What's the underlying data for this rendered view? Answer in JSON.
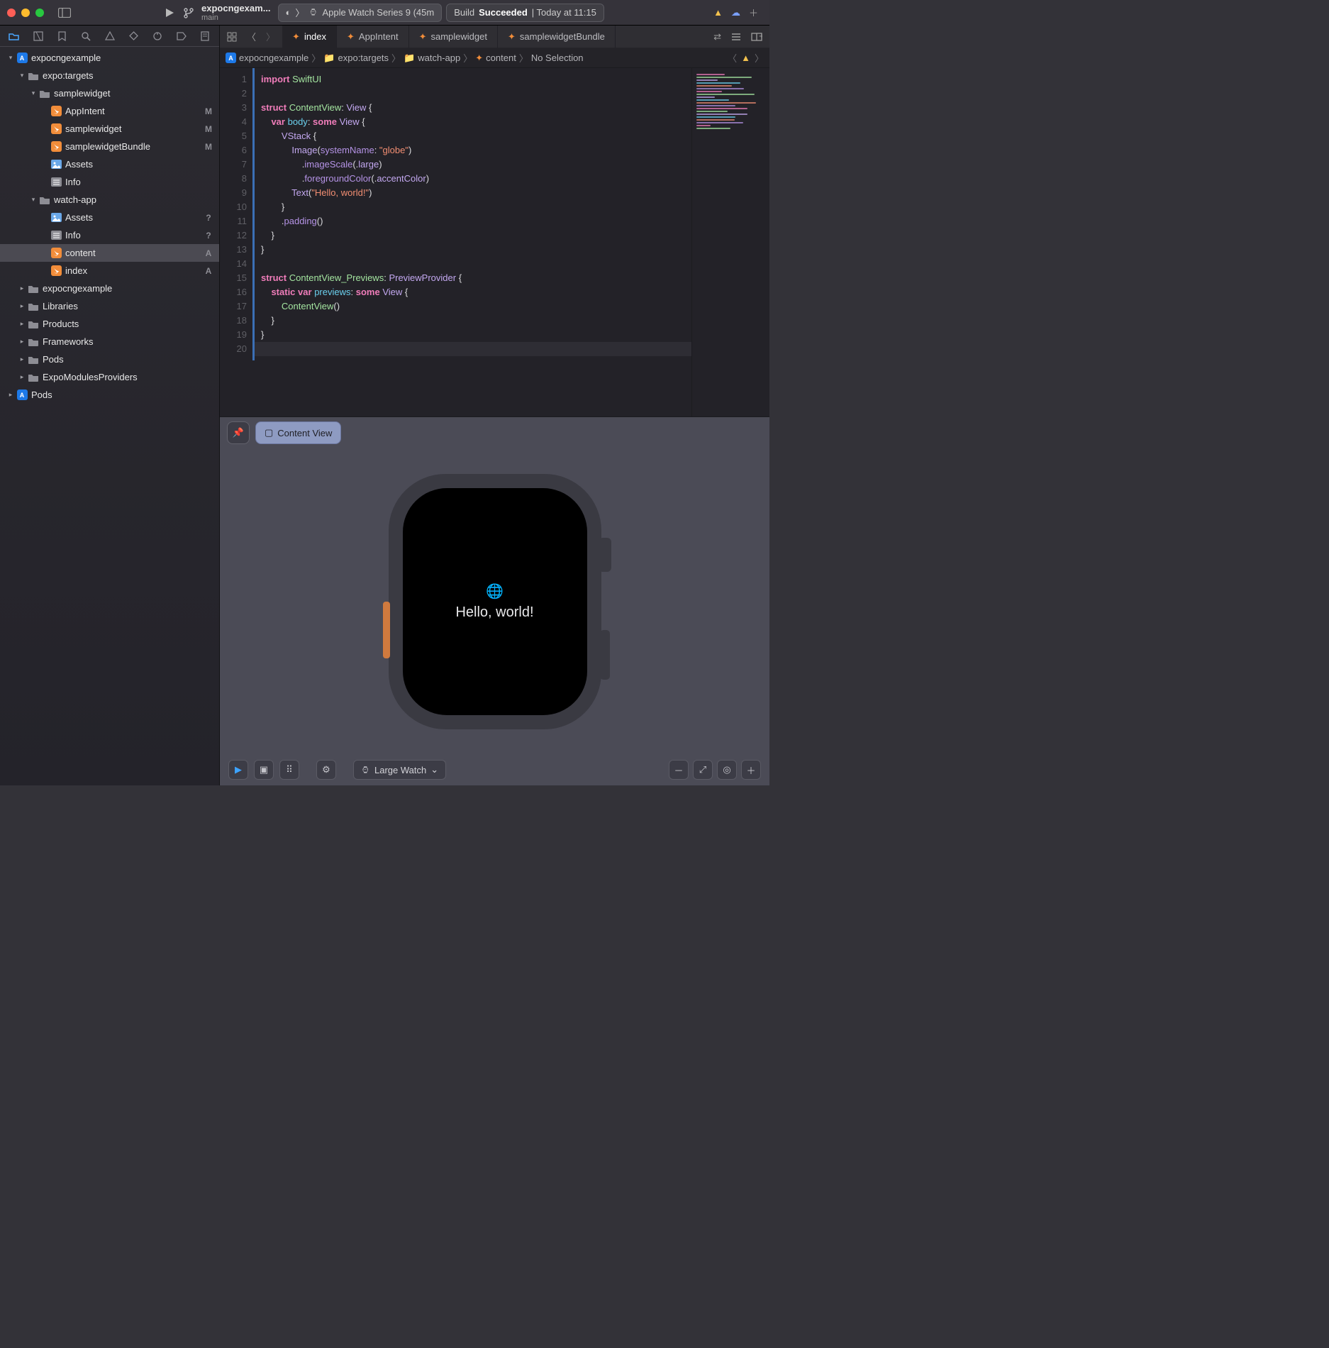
{
  "titlebar": {
    "project": "expocngexam...",
    "branch": "main",
    "schemeArrow": "〉",
    "device": "Apple Watch Series 9 (45m",
    "statusPrefix": "Build ",
    "statusStrong": "Succeeded",
    "statusSuffix": " | Today at 11:15"
  },
  "navigator": {
    "tree": [
      {
        "depth": 0,
        "disclosure": "▾",
        "icon": "proj",
        "label": "expocngexample",
        "badge": ""
      },
      {
        "depth": 1,
        "disclosure": "▾",
        "icon": "folder-blue",
        "label": "expo:targets",
        "badge": ""
      },
      {
        "depth": 2,
        "disclosure": "▾",
        "icon": "folder",
        "label": "samplewidget",
        "badge": ""
      },
      {
        "depth": 3,
        "disclosure": "",
        "icon": "swift",
        "label": "AppIntent",
        "badge": "M"
      },
      {
        "depth": 3,
        "disclosure": "",
        "icon": "swift",
        "label": "samplewidget",
        "badge": "M"
      },
      {
        "depth": 3,
        "disclosure": "",
        "icon": "swift",
        "label": "samplewidgetBundle",
        "badge": "M"
      },
      {
        "depth": 3,
        "disclosure": "",
        "icon": "xc",
        "label": "Assets",
        "badge": ""
      },
      {
        "depth": 3,
        "disclosure": "",
        "icon": "plist",
        "label": "Info",
        "badge": ""
      },
      {
        "depth": 2,
        "disclosure": "▾",
        "icon": "folder",
        "label": "watch-app",
        "badge": ""
      },
      {
        "depth": 3,
        "disclosure": "",
        "icon": "xc",
        "label": "Assets",
        "badge": "?"
      },
      {
        "depth": 3,
        "disclosure": "",
        "icon": "plist",
        "label": "Info",
        "badge": "?"
      },
      {
        "depth": 3,
        "disclosure": "",
        "icon": "swift",
        "label": "content",
        "badge": "A",
        "selected": true
      },
      {
        "depth": 3,
        "disclosure": "",
        "icon": "swift",
        "label": "index",
        "badge": "A"
      },
      {
        "depth": 1,
        "disclosure": "▸",
        "icon": "folder",
        "label": "expocngexample",
        "badge": ""
      },
      {
        "depth": 1,
        "disclosure": "▸",
        "icon": "folder",
        "label": "Libraries",
        "badge": ""
      },
      {
        "depth": 1,
        "disclosure": "▸",
        "icon": "folder",
        "label": "Products",
        "badge": ""
      },
      {
        "depth": 1,
        "disclosure": "▸",
        "icon": "folder",
        "label": "Frameworks",
        "badge": ""
      },
      {
        "depth": 1,
        "disclosure": "▸",
        "icon": "folder",
        "label": "Pods",
        "badge": ""
      },
      {
        "depth": 1,
        "disclosure": "▸",
        "icon": "folder",
        "label": "ExpoModulesProviders",
        "badge": ""
      },
      {
        "depth": 0,
        "disclosure": "▸",
        "icon": "proj",
        "label": "Pods",
        "badge": ""
      }
    ]
  },
  "tabs": [
    "index",
    "AppIntent",
    "samplewidget",
    "samplewidgetBundle"
  ],
  "activeTab": 0,
  "pathbar": [
    "expocngexample",
    "expo:targets",
    "watch-app",
    "content",
    "No Selection"
  ],
  "code": {
    "lines": 20,
    "html": [
      "<span class='tok-kw'>import</span> <span class='tok-type'>SwiftUI</span>",
      "",
      "<span class='tok-kw'>struct</span> <span class='tok-type'>ContentView</span>: <span class='tok-typed'>View</span> {",
      "    <span class='tok-kw'>var</span> <span class='tok-id'>body</span>: <span class='tok-kw'>some</span> <span class='tok-typed'>View</span> {",
      "        <span class='tok-typed'>VStack</span> {",
      "            <span class='tok-typed'>Image</span>(<span class='tok-func'>systemName</span>: <span class='tok-str'>\"globe\"</span>)",
      "                .<span class='tok-func'>imageScale</span>(.<span class='tok-enum'>large</span>)",
      "                .<span class='tok-func'>foregroundColor</span>(.<span class='tok-enum'>accentColor</span>)",
      "            <span class='tok-typed'>Text</span>(<span class='tok-str'>\"Hello, world!\"</span>)",
      "        }",
      "        .<span class='tok-func'>padding</span>()",
      "    }",
      "}",
      "",
      "<span class='tok-kw'>struct</span> <span class='tok-type'>ContentView_Previews</span>: <span class='tok-typed'>PreviewProvider</span> {",
      "    <span class='tok-kw'>static</span> <span class='tok-kw'>var</span> <span class='tok-id'>previews</span>: <span class='tok-kw'>some</span> <span class='tok-typed'>View</span> {",
      "        <span class='tok-type'>ContentView</span>()",
      "    }",
      "}",
      ""
    ]
  },
  "preview": {
    "chipLabel": "Content View",
    "helloText": "Hello, world!",
    "deviceLabel": "Large Watch"
  }
}
